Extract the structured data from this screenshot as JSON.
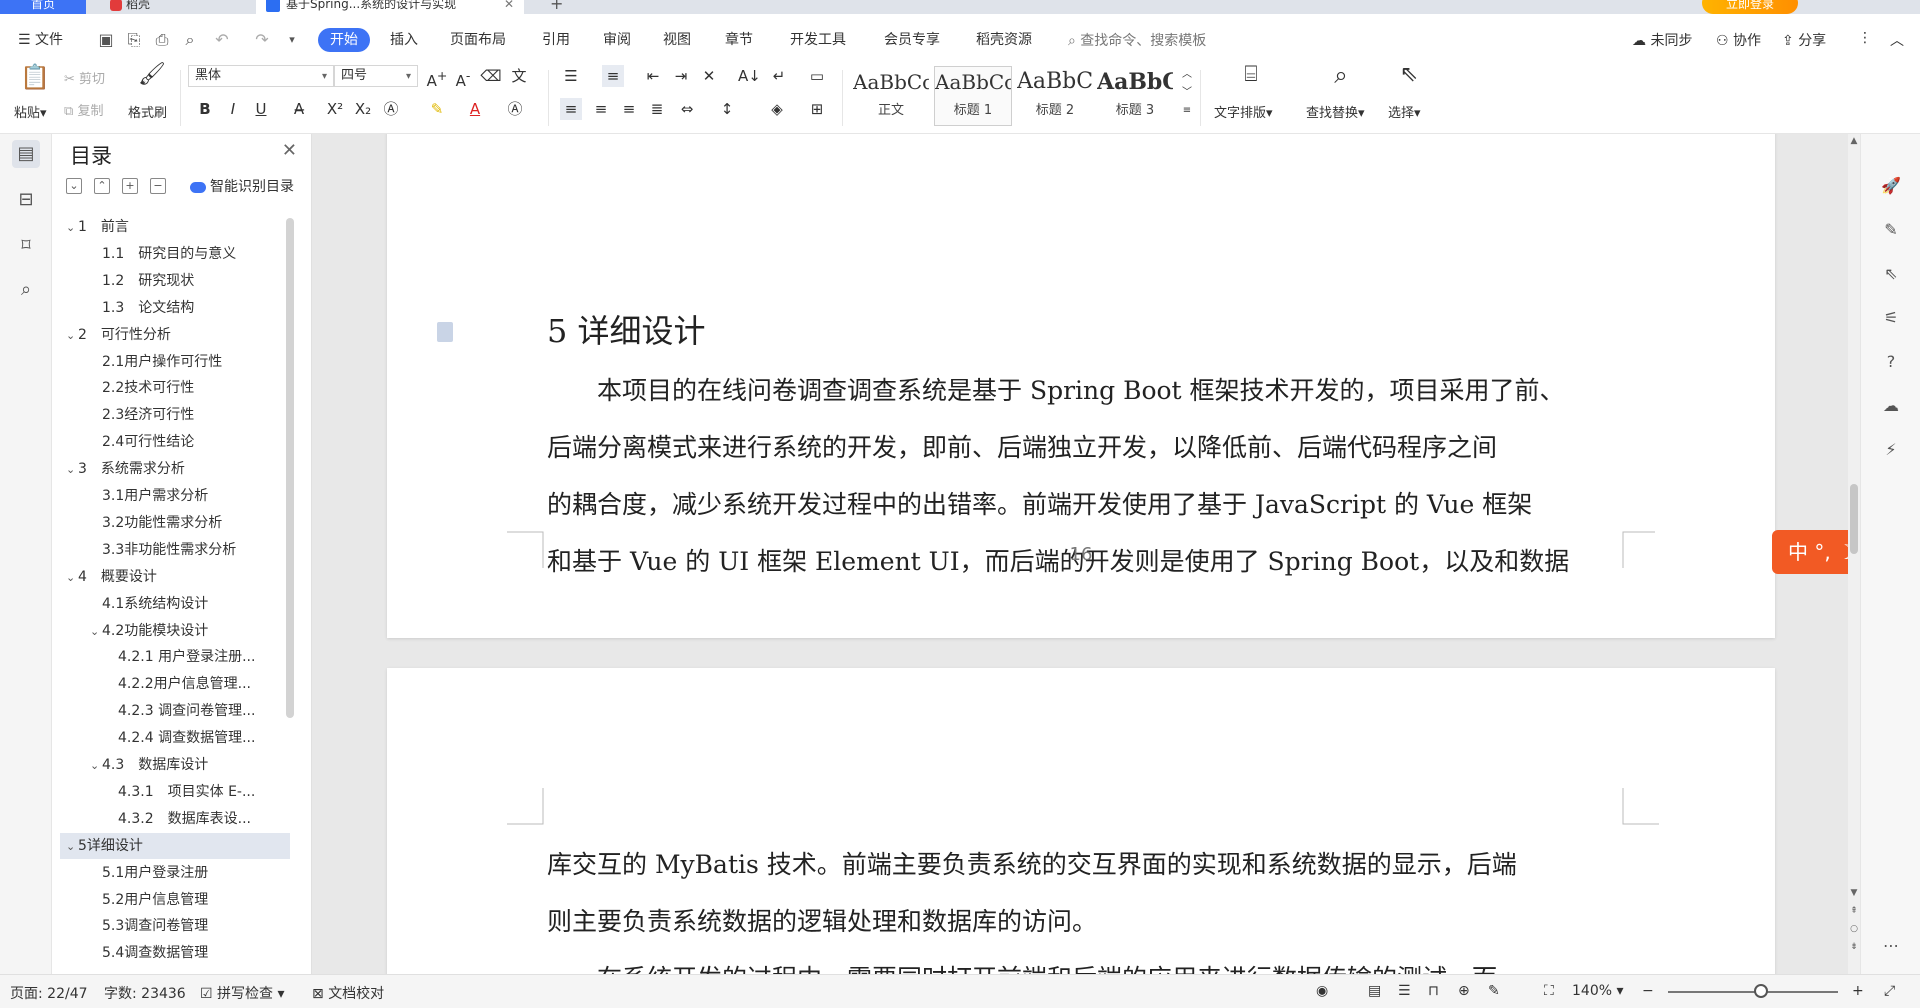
{
  "titlebar": {
    "tabs": [
      {
        "label": "首页"
      },
      {
        "label": "稻壳"
      },
      {
        "label": "基于Spring...系统的设计与实现"
      },
      {
        "label": "+"
      }
    ],
    "login_label": "立即登录"
  },
  "menubar": {
    "file_label": "文件",
    "tabs": [
      "开始",
      "插入",
      "页面布局",
      "引用",
      "审阅",
      "视图",
      "章节",
      "开发工具",
      "会员专享",
      "稻壳资源"
    ],
    "search_placeholder": "查找命令、搜索模板",
    "sync_label": "未同步",
    "collab_label": "协作",
    "share_label": "分享"
  },
  "ribbon": {
    "paste_label": "粘贴",
    "cut_label": "剪切",
    "copy_label": "复制",
    "format_painter_label": "格式刷",
    "font_name": "黑体",
    "font_size": "四号",
    "styles": [
      {
        "preview": "AaBbCcDd",
        "caption": "正文"
      },
      {
        "preview": "AaBbCcD",
        "caption": "标题 1"
      },
      {
        "preview": "AaBbCcD",
        "caption": "标题 2"
      },
      {
        "preview": "AaBbC",
        "caption": "标题 3"
      }
    ],
    "text_layout_label": "文字排版",
    "find_replace_label": "查找替换",
    "select_label": "选择"
  },
  "toc": {
    "title": "目录",
    "smart_label": "智能识别目录",
    "items": [
      {
        "label": "1　前言",
        "level": 1,
        "expanded": true
      },
      {
        "label": "1.1　研究目的与意义",
        "level": 2
      },
      {
        "label": "1.2　研究现状",
        "level": 2
      },
      {
        "label": "1.3　论文结构",
        "level": 2
      },
      {
        "label": "2　可行性分析",
        "level": 1,
        "expanded": true
      },
      {
        "label": "2.1用户操作可行性",
        "level": 2
      },
      {
        "label": "2.2技术可行性",
        "level": 2
      },
      {
        "label": "2.3经济可行性",
        "level": 2
      },
      {
        "label": "2.4可行性结论",
        "level": 2
      },
      {
        "label": "3　系统需求分析",
        "level": 1,
        "expanded": true
      },
      {
        "label": "3.1用户需求分析",
        "level": 2
      },
      {
        "label": "3.2功能性需求分析",
        "level": 2
      },
      {
        "label": "3.3非功能性需求分析",
        "level": 2
      },
      {
        "label": "4　概要设计",
        "level": 1,
        "expanded": true
      },
      {
        "label": "4.1系统结构设计",
        "level": 2
      },
      {
        "label": "4.2功能模块设计",
        "level": 2,
        "expanded": true
      },
      {
        "label": "4.2.1 用户登录注册...",
        "level": 3
      },
      {
        "label": "4.2.2用户信息管理...",
        "level": 3
      },
      {
        "label": "4.2.3 调查问卷管理...",
        "level": 3
      },
      {
        "label": "4.2.4 调查数据管理...",
        "level": 3
      },
      {
        "label": "4.3　数据库设计",
        "level": 2,
        "expanded": true
      },
      {
        "label": "4.3.1　项目实体 E-...",
        "level": 3
      },
      {
        "label": "4.3.2　数据库表设...",
        "level": 3
      },
      {
        "label": "5详细设计",
        "level": 1,
        "expanded": true,
        "selected": true
      },
      {
        "label": "5.1用户登录注册",
        "level": 2
      },
      {
        "label": "5.2用户信息管理",
        "level": 2
      },
      {
        "label": "5.3调查问卷管理",
        "level": 2
      },
      {
        "label": "5.4调查数据管理",
        "level": 2
      }
    ]
  },
  "document": {
    "heading": "5 详细设计",
    "page1_lines": [
      "　　本项目的在线问卷调查调查系统是基于 Spring Boot 框架技术开发的，项目采用了前、",
      "后端分离模式来进行系统的开发，即前、后端独立开发，以降低前、后端代码程序之间",
      "的耦合度，减少系统开发过程中的出错率。前端开发使用了基于 JavaScript 的 Vue 框架",
      "和基于 Vue 的 UI 框架 Element UI，而后端的开发则是使用了 Spring Boot，以及和数据"
    ],
    "page_number": "16",
    "page2_lines": [
      "库交互的 MyBatis 技术。前端主要负责系统的交互界面的实现和系统数据的显示，后端",
      "则主要负责系统数据的逻辑处理和数据库的访问。",
      "　　在系统开发的过程中，需要同时打开前端和后端的应用来进行数据传输的测试，而"
    ]
  },
  "ime": {
    "label": "中 °, ☽"
  },
  "statusbar": {
    "page_info": "页面: 22/47",
    "word_count": "字数: 23436",
    "spellcheck_label": "拼写检查",
    "proofread_label": "文档校对",
    "zoom": "140%"
  },
  "colors": {
    "accent": "#3d73f5",
    "ime": "#f25a24"
  }
}
